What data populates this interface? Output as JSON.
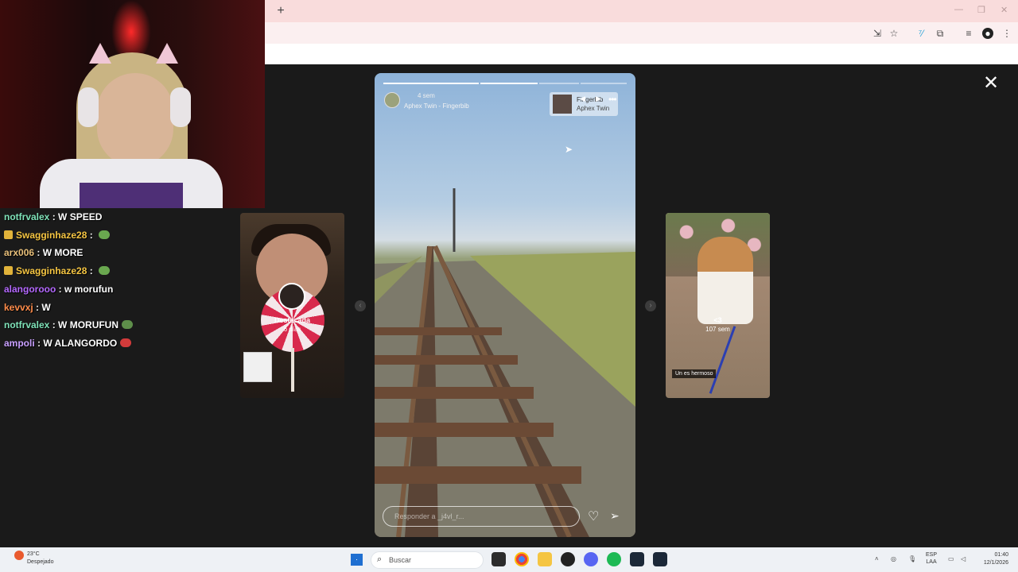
{
  "browser": {
    "new_tab_label": "+",
    "toolbar_icons": [
      "install-icon",
      "star-icon",
      "extension-translate-icon",
      "extensions-icon",
      "media-icon",
      "profile-icon",
      "menu-icon"
    ]
  },
  "story_viewer": {
    "close_label": "✕",
    "main_story": {
      "time": "4 sem",
      "song": "Aphex Twin - Fingerbib",
      "music_card": {
        "title": "Fingerbib",
        "artist": "Aphex Twin"
      },
      "reply_placeholder": "Responder a _j4vl_r...",
      "progress_segments": 4,
      "progress_filled": 0.75
    },
    "prev_story": {
      "name": "Destacada",
      "time": "6 días"
    },
    "next_story": {
      "badge": "<3",
      "time": "107 sem",
      "sticker": "Un es hermoso"
    }
  },
  "chat": [
    {
      "user": "notfrvalex",
      "user_color": "#7fe3b9",
      "text": "W SPEED",
      "badge": false,
      "emote": false
    },
    {
      "user": "Swagginhaze28",
      "user_color": "#f5c542",
      "text": "",
      "badge": true,
      "emote": true,
      "emote_color": "#6aa84f"
    },
    {
      "user": "arx006",
      "user_color": "#e9c07a",
      "text": "W MORE",
      "badge": false,
      "emote": false
    },
    {
      "user": "Swagginhaze28",
      "user_color": "#f5c542",
      "text": "",
      "badge": true,
      "emote": true,
      "emote_color": "#6aa84f"
    },
    {
      "user": "alangorooo",
      "user_color": "#b468ff",
      "text": "w morufun",
      "badge": false,
      "emote": false
    },
    {
      "user": "kevvxj",
      "user_color": "#ff8c4a",
      "text": "W",
      "badge": false,
      "emote": false
    },
    {
      "user": "notfrvalex",
      "user_color": "#7fe3b9",
      "text": "W MORUFUN",
      "badge": false,
      "emote": true,
      "emote_color": "#5e8f4a"
    },
    {
      "user": "ampoli",
      "user_color": "#c9a0ff",
      "text": "W ALANGORDO",
      "badge": false,
      "emote": true,
      "emote_color": "#d33b3b"
    }
  ],
  "taskbar": {
    "weather_temp": "23°C",
    "weather_desc": "Despejado",
    "search_placeholder": "Buscar",
    "lang_line1": "ESP",
    "lang_line2": "LAA",
    "time": "01:40",
    "date": "12/1/2026"
  }
}
